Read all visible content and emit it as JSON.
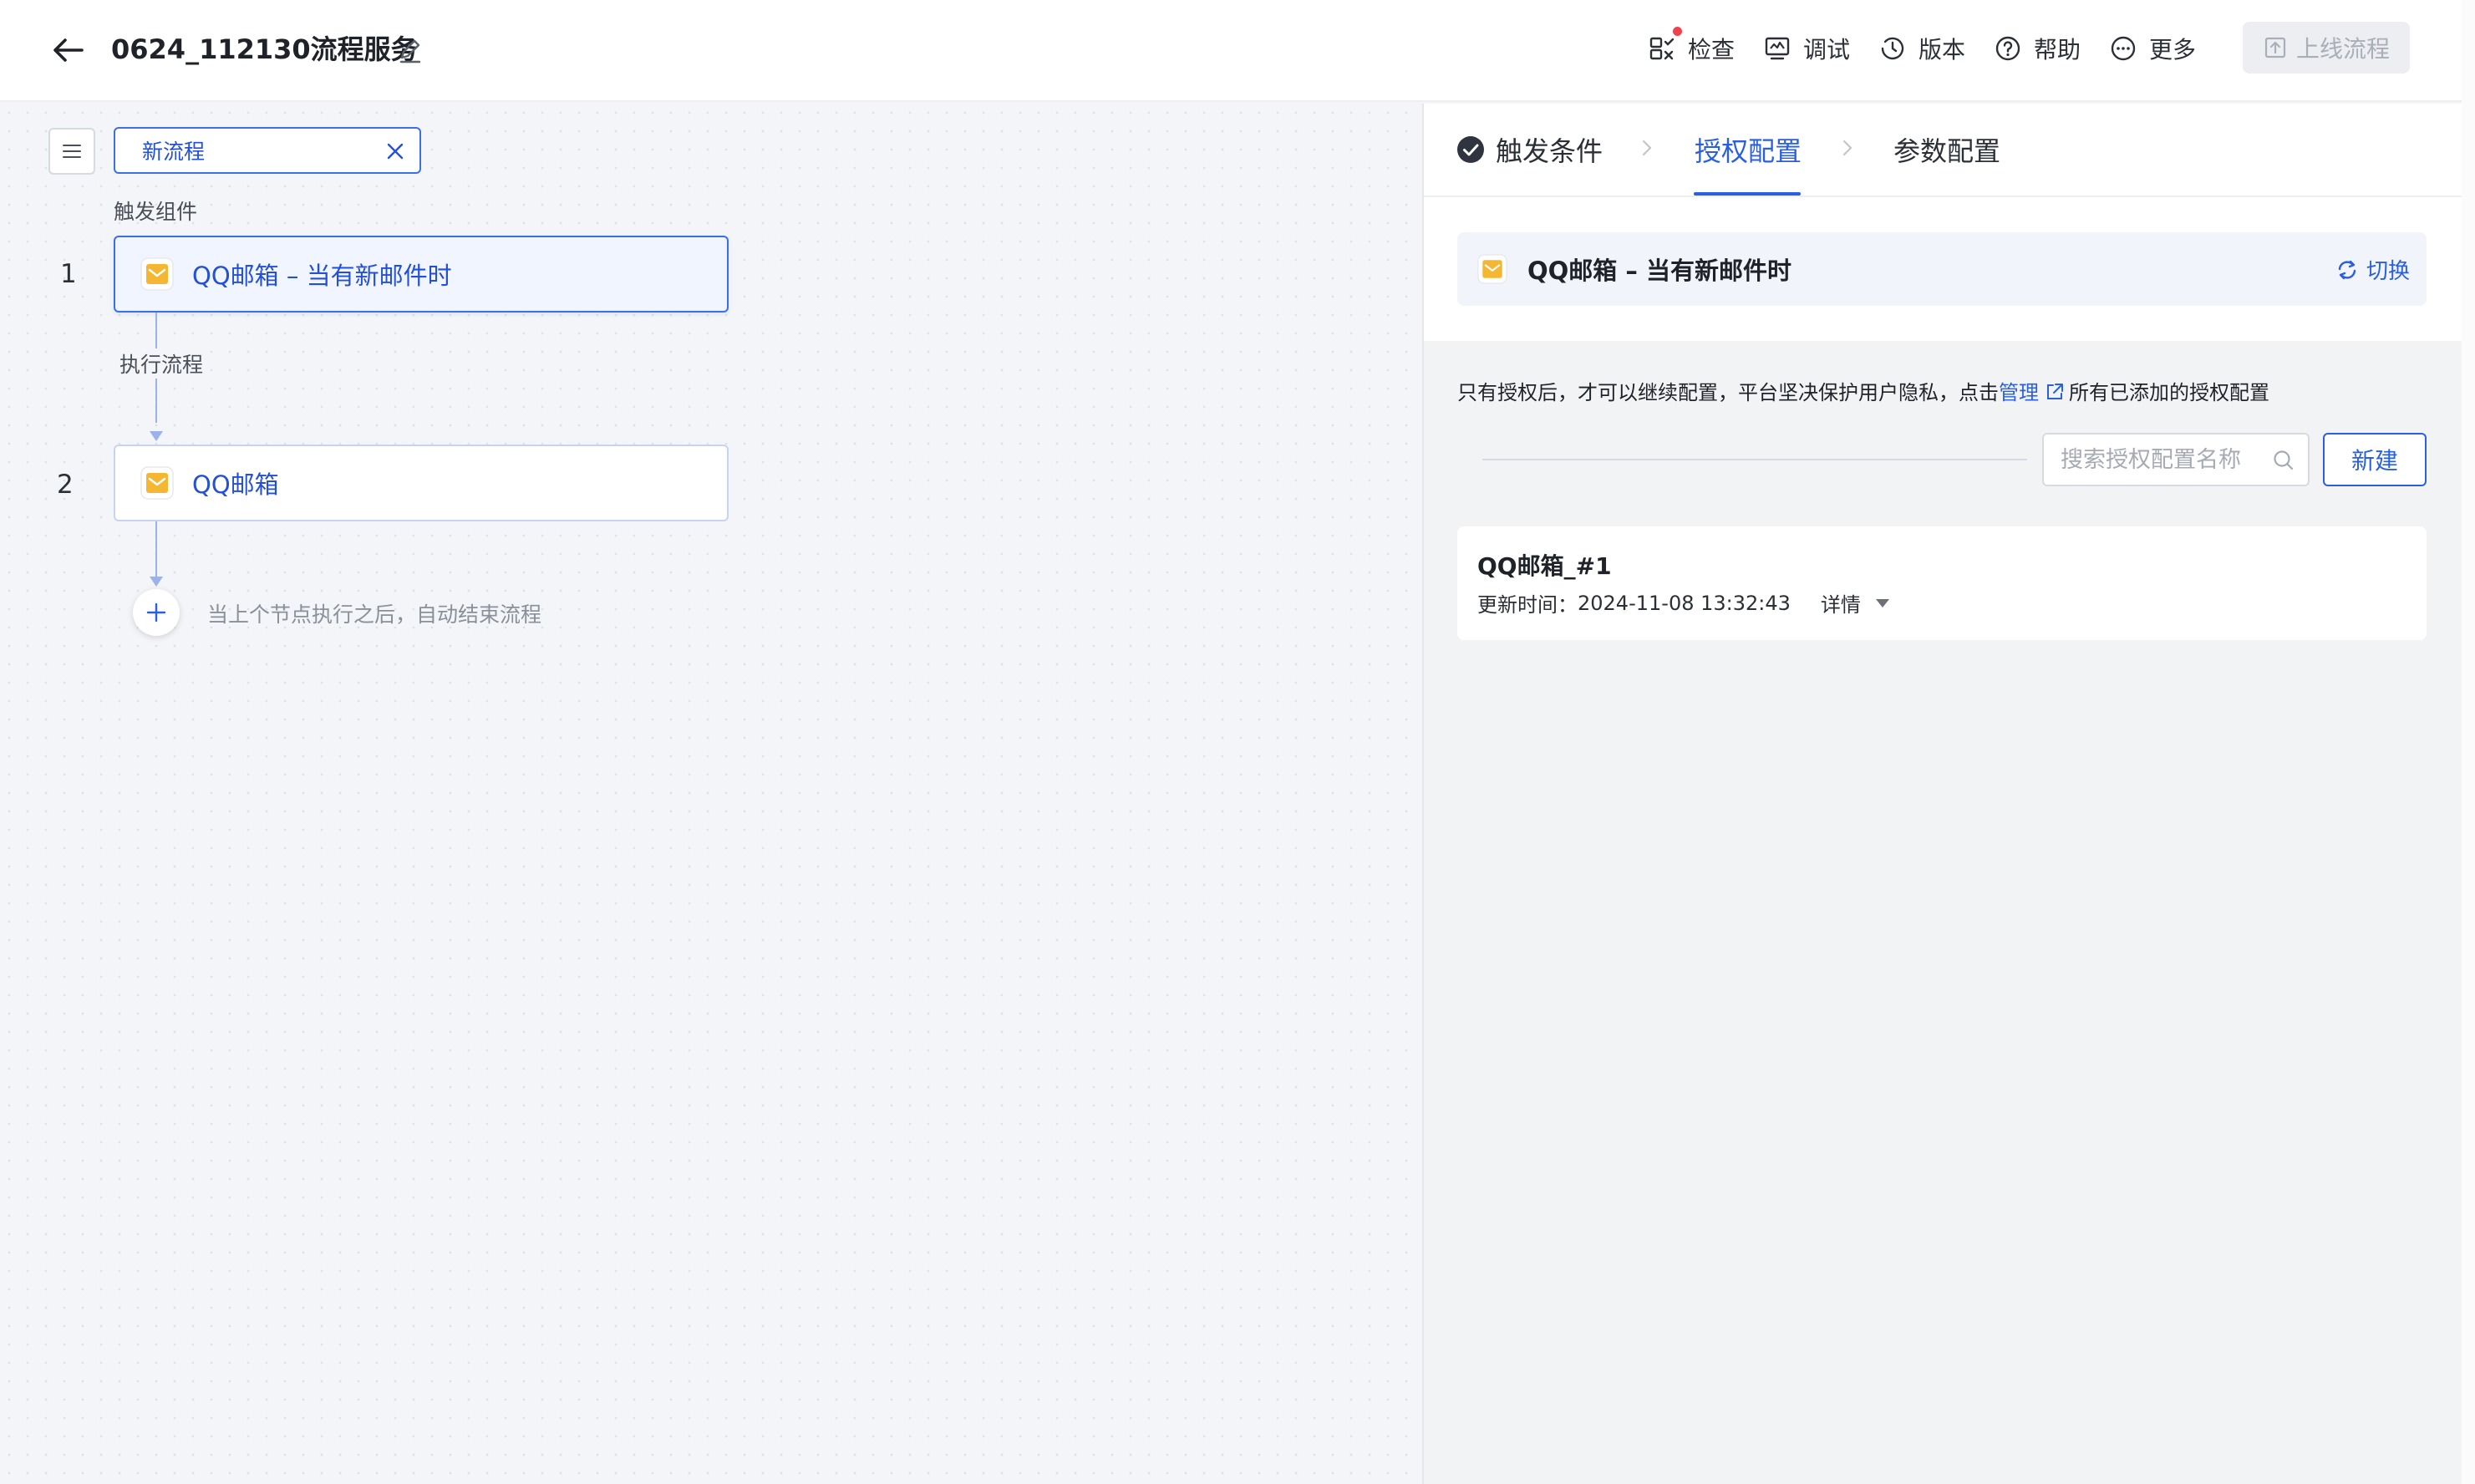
{
  "header": {
    "title": "0624_112130流程服务",
    "toolbar": {
      "check": "检查",
      "debug": "调试",
      "version": "版本",
      "help": "帮助",
      "more": "更多"
    },
    "publish_label": "上线流程",
    "check_badge_color": "#f0424e"
  },
  "canvas": {
    "flow_tag": "新流程",
    "trigger_section": "触发组件",
    "exec_section": "执行流程",
    "nodes": [
      {
        "index": "1",
        "label": "QQ邮箱 – 当有新邮件时"
      },
      {
        "index": "2",
        "label": "QQ邮箱"
      }
    ],
    "end_hint": "当上个节点执行之后，自动结束流程"
  },
  "panel": {
    "steps": [
      {
        "label": "触发条件",
        "state": "done"
      },
      {
        "label": "授权配置",
        "state": "current"
      },
      {
        "label": "参数配置",
        "state": "pending"
      }
    ],
    "trigger_card": {
      "label": "QQ邮箱 – 当有新邮件时",
      "switch_label": "切换"
    },
    "auth_note": {
      "before": "只有授权后，才可以继续配置，平台坚决保护用户隐私，点击",
      "link": "管理",
      "after": "所有已添加的授权配置"
    },
    "search_placeholder": "搜索授权配置名称",
    "new_button": "新建",
    "auth_items": [
      {
        "name": "QQ邮箱_#1",
        "updated_label": "更新时间：",
        "updated_value": "2024-11-08 13:32:43",
        "detail_label": "详情"
      }
    ]
  },
  "colors": {
    "primary": "#2a5fe0",
    "node_border": "#3a6fe8",
    "mail_icon": "#f5b731"
  }
}
